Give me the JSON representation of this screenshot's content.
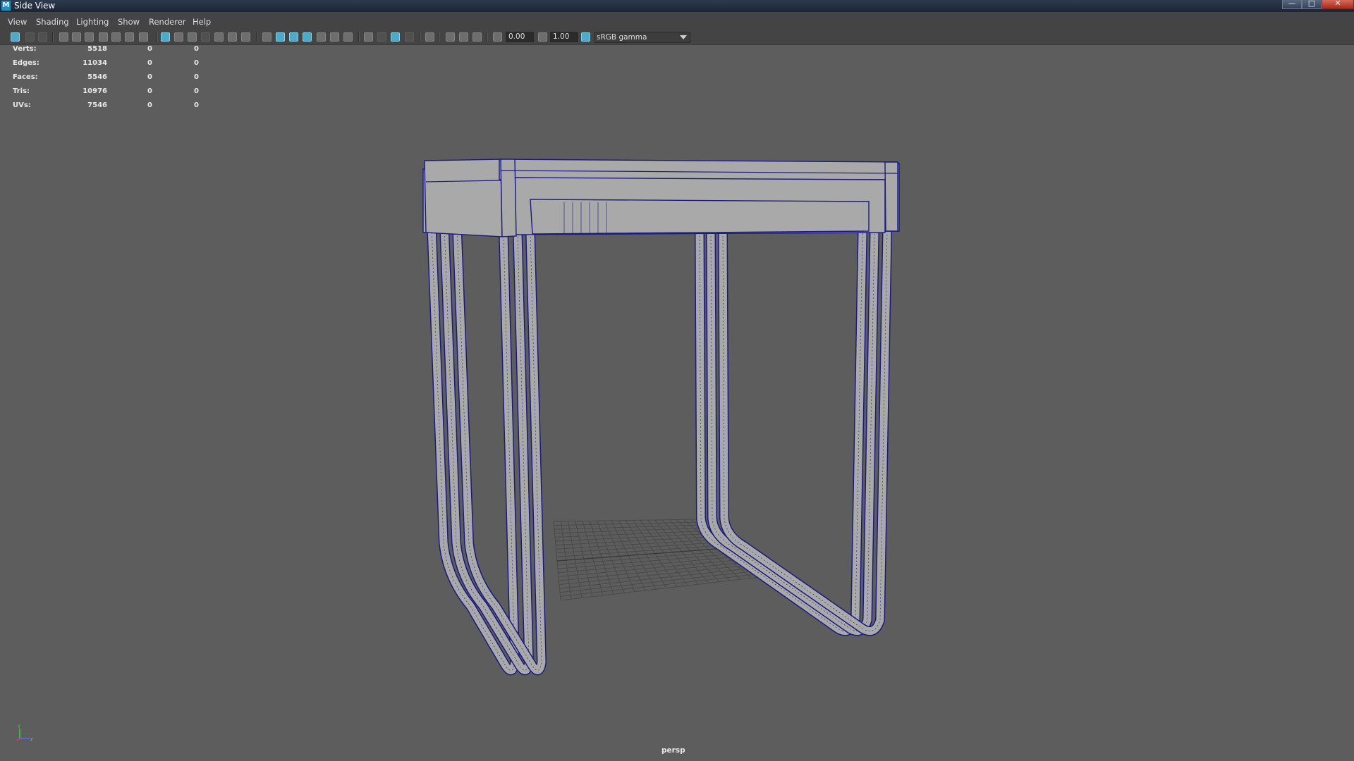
{
  "window": {
    "app_icon_letter": "M",
    "title": "Side View",
    "minimize_glyph": "—",
    "maximize_glyph": "□",
    "close_glyph": "✕"
  },
  "menu": {
    "items": [
      "View",
      "Shading",
      "Lighting",
      "Show",
      "Renderer",
      "Help"
    ]
  },
  "toolbar": {
    "exposure_value": "0.00",
    "gamma_value": "1.00",
    "color_space": "sRGB gamma"
  },
  "hud": {
    "rows": [
      {
        "label": "Verts:",
        "v1": "5518",
        "v2": "0",
        "v3": "0"
      },
      {
        "label": "Edges:",
        "v1": "11034",
        "v2": "0",
        "v3": "0"
      },
      {
        "label": "Faces:",
        "v1": "5546",
        "v2": "0",
        "v3": "0"
      },
      {
        "label": "Tris:",
        "v1": "10976",
        "v2": "0",
        "v3": "0"
      },
      {
        "label": "UVs:",
        "v1": "7546",
        "v2": "0",
        "v3": "0"
      }
    ]
  },
  "viewport": {
    "camera_name": "persp",
    "axis_labels": {
      "y": "y",
      "z": "z"
    }
  },
  "colors": {
    "viewport_bg": "#5d5d5d",
    "wireframe": "#1a1a80",
    "mesh_fill": "#a9a9a9",
    "active_icon": "#4fa9c9",
    "menubar_bg": "#444444"
  }
}
